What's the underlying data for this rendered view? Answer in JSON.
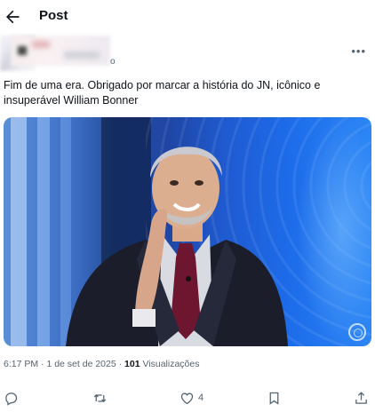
{
  "header": {
    "title": "Post"
  },
  "author": {
    "handle_tail": "o"
  },
  "tweet": {
    "text": "Fim de uma era. Obrigado por marcar a história do JN, icônico e insuperável William Bonner",
    "time": "6:17 PM",
    "sep1": " · ",
    "date": "1 de set de 2025",
    "sep2": " · ",
    "views_count": "101",
    "views_label": " Visualizações"
  },
  "actions": {
    "replies": "",
    "reposts": "",
    "likes": "4",
    "bookmarks": ""
  },
  "icons": {
    "back": "arrow-left",
    "more": "more-horizontal",
    "reply": "speech-bubble",
    "repost": "retweet-arrows",
    "like": "heart",
    "bookmark": "bookmark",
    "share": "share-upload"
  },
  "colors": {
    "text": "#0f1419",
    "secondary": "#536471",
    "background": "#ffffff"
  }
}
